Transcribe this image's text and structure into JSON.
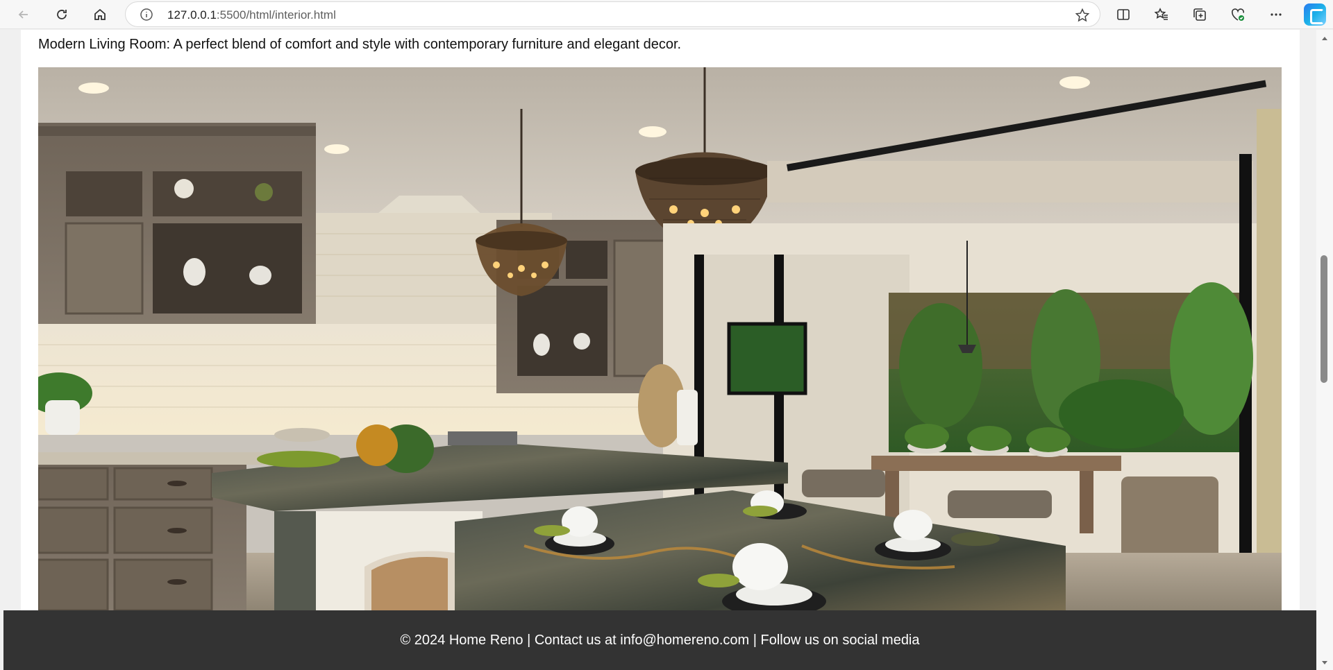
{
  "browser": {
    "url_host": "127.0.0.1",
    "url_rest": ":5500/html/interior.html",
    "icons": [
      "back-icon",
      "refresh-icon",
      "home-icon",
      "info-icon",
      "star-icon",
      "split-screen-icon",
      "favorites-icon",
      "collections-icon",
      "browser-essentials-icon",
      "more-icon",
      "copilot-icon"
    ]
  },
  "page": {
    "caption": "Modern Living Room: A perfect blend of comfort and style with contemporary furniture and elegant decor.",
    "footer": "© 2024 Home Reno | Contact us at info@homereno.com | Follow us on social media"
  },
  "colors": {
    "footer_bg": "#333333",
    "page_bg": "#f0f0f0",
    "card_bg": "#ffffff"
  }
}
